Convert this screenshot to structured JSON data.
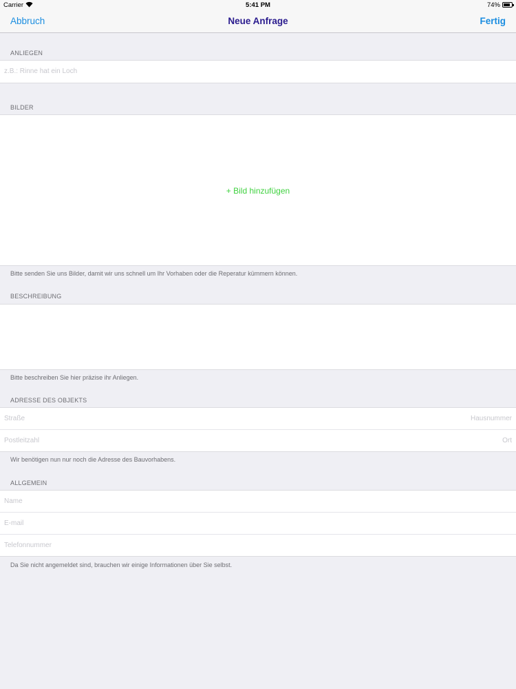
{
  "status_bar": {
    "carrier": "Carrier",
    "time": "5:41 PM",
    "battery": "74%",
    "wifi_icon": "wifi-icon",
    "battery_icon": "battery-icon"
  },
  "nav": {
    "cancel": "Abbruch",
    "title": "Neue Anfrage",
    "done": "Fertig",
    "accent_color": "#1a8de0",
    "title_color": "#2a1b8e"
  },
  "anliegen": {
    "header": "ANLIEGEN",
    "placeholder": "z.B.: Rinne hat ein Loch"
  },
  "bilder": {
    "header": "BILDER",
    "add_label": "+ Bild hinzufügen",
    "add_color": "#3fd13f",
    "footer": "Bitte senden Sie uns Bilder, damit wir uns schnell um Ihr Vorhaben oder die Reperatur kümmern können."
  },
  "beschreibung": {
    "header": "BESCHREIBUNG",
    "footer": "Bitte beschreiben Sie hier präzise ihr Anliegen."
  },
  "adresse": {
    "header": "ADRESSE DES OBJEKTS",
    "street_placeholder": "Straße",
    "house_number_placeholder": "Hausnummer",
    "postal_code_placeholder": "Postleitzahl",
    "city_placeholder": "Ort",
    "footer": "Wir benötigen nun nur noch die Adresse des Bauvorhabens."
  },
  "allgemein": {
    "header": "ALLGEMEIN",
    "name_placeholder": "Name",
    "email_placeholder": "E-mail",
    "phone_placeholder": "Telefonnummer",
    "footer": "Da Sie nicht angemeldet sind, brauchen wir einige Informationen über Sie selbst."
  }
}
